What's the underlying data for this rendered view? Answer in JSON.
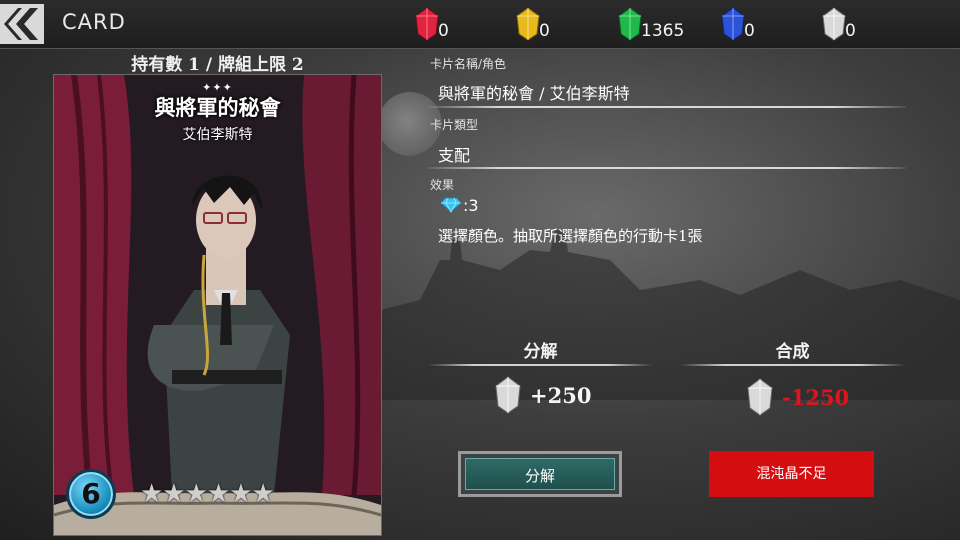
{
  "header": {
    "title": "CARD",
    "resources": [
      {
        "color": "#e0233f",
        "icon": "red-crystal-icon",
        "value": "0"
      },
      {
        "color": "#e8b91c",
        "icon": "yellow-crystal-icon",
        "value": "0"
      },
      {
        "color": "#1fb84a",
        "icon": "green-crystal-icon",
        "value": "1365"
      },
      {
        "color": "#2b52d8",
        "icon": "blue-crystal-icon",
        "value": "0"
      },
      {
        "color": "#d9d9d9",
        "icon": "white-crystal-icon",
        "value": "0"
      }
    ]
  },
  "card": {
    "ownership": "持有數 1 / 牌組上限 2",
    "sparkle": "✦✦✦",
    "name": "與將軍的秘會",
    "character": "艾伯李斯特",
    "cost": "6",
    "stars": "★★★★★★"
  },
  "info": {
    "name_label": "卡片名稱/角色",
    "name_value": "與將軍的秘會 / 艾伯李斯特",
    "type_label": "卡片類型",
    "type_value": "支配",
    "effect_label": "效果",
    "effect_gem_count": ":3",
    "effect_text": "選擇顏色。抽取所選擇顏色的行動卡1張"
  },
  "dismantle": {
    "title": "分解",
    "amount": "+250",
    "button": "分解"
  },
  "compose": {
    "title": "合成",
    "amount": "-1250",
    "button": "混沌晶不足"
  }
}
